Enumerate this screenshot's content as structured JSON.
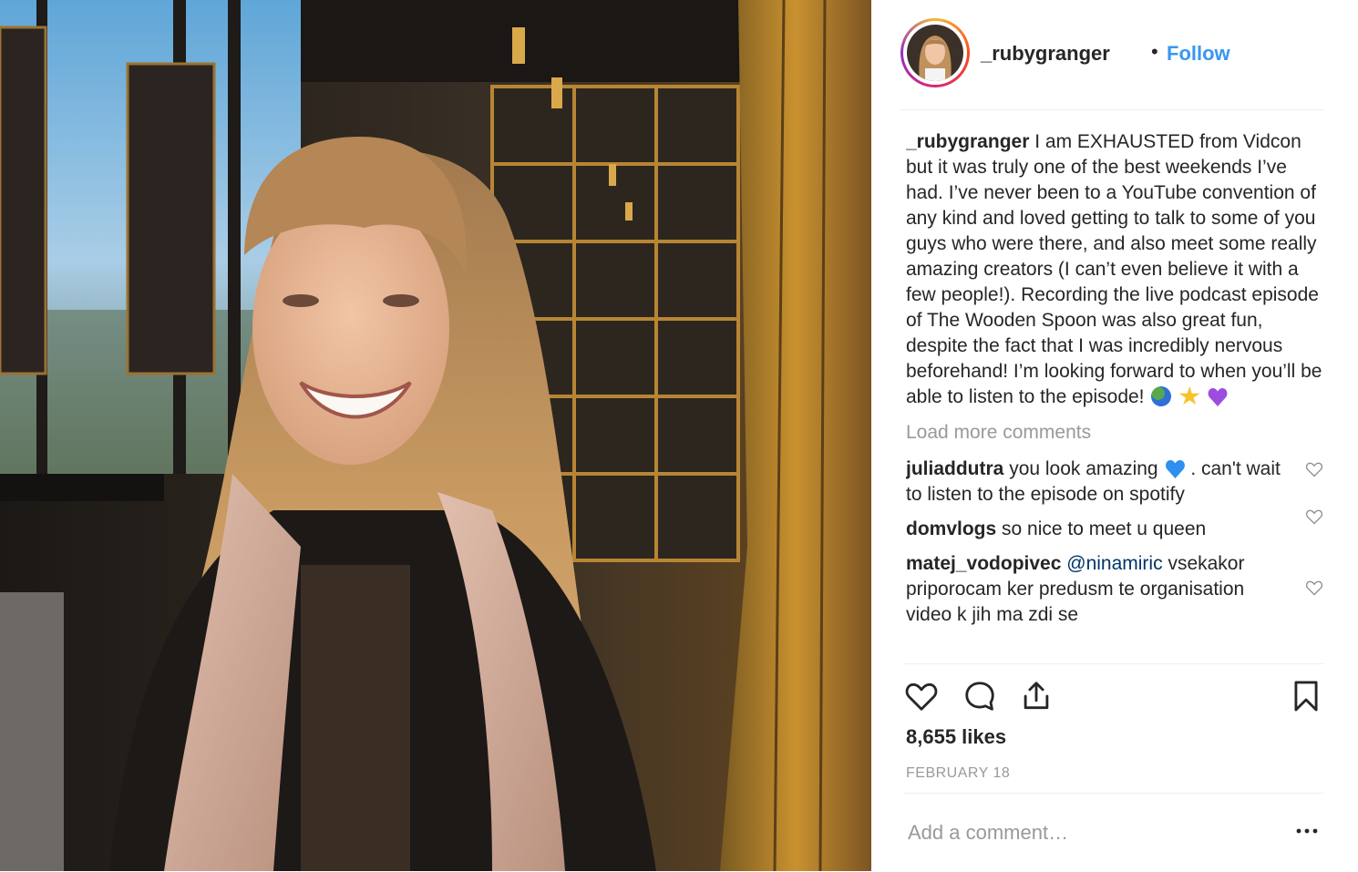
{
  "post": {
    "username": "_rubygranger",
    "follow_label": "Follow",
    "separator": "•",
    "caption_user": "_rubygranger",
    "caption_text": "I am EXHAUSTED from Vidcon but it was truly one of the best weekends I’ve had. I’ve never been to a YouTube convention of any kind and loved getting to talk to some of you guys who were there, and also meet some really amazing creators (I can’t even believe it with a few people!). Recording the live podcast episode of The Wooden Spoon was also great fun, despite the fact that I was incredibly nervous beforehand! I’m looking forward to when you’ll be able to listen to the episode!",
    "caption_emojis": [
      "globe-emoji",
      "star-emoji",
      "purple-heart-emoji"
    ],
    "load_more": "Load more comments",
    "comments": [
      {
        "user": "juliaddutra",
        "text_before": "you look amazing",
        "emoji": "blue-heart-emoji",
        "text_after": ". can't wait to listen to the episode on spotify"
      },
      {
        "user": "domvlogs",
        "text": "so nice to meet u queen"
      },
      {
        "user": "matej_vodopivec",
        "mention": "@ninamiric",
        "text": "vsekakor priporocam ker predusm te organisation video k jih ma zdi se"
      }
    ],
    "likes": "8,655 likes",
    "date": "FEBRUARY 18",
    "add_comment_placeholder": "Add a comment…"
  },
  "icons": {
    "like": "heart-icon",
    "comment": "comment-bubble-icon",
    "share": "share-icon",
    "save": "bookmark-icon",
    "more": "more-options-icon"
  },
  "colors": {
    "link": "#3897f0",
    "text": "#262626",
    "muted": "#999999",
    "mention": "#003569",
    "divider": "#efefef"
  }
}
